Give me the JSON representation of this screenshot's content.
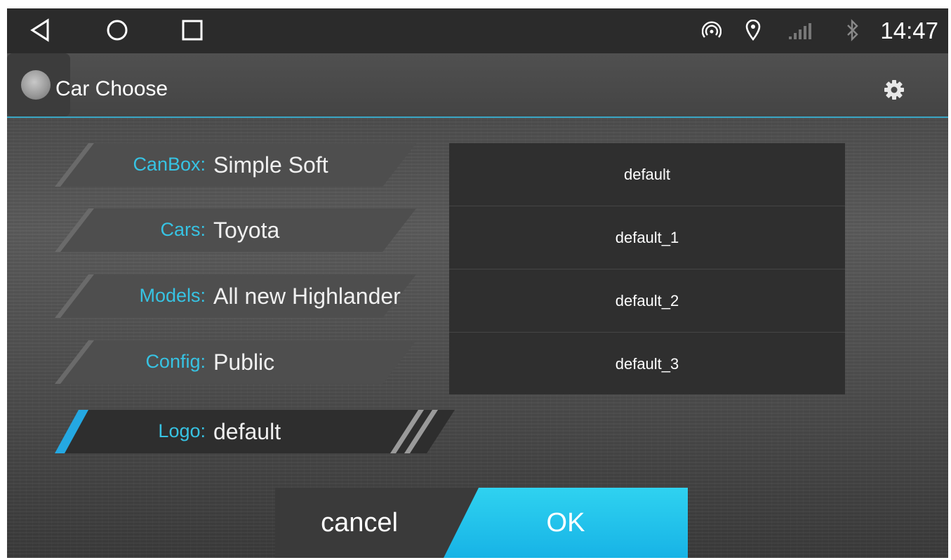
{
  "status_bar": {
    "nav_icons": [
      "back-icon",
      "home-icon",
      "recents-icon"
    ],
    "status_icons": [
      "hotspot-icon",
      "location-icon",
      "signal-icon",
      "bluetooth-icon"
    ],
    "time": "14:47"
  },
  "title_bar": {
    "title": "Car Choose",
    "settings_icon": "gear-icon"
  },
  "settings_rows": [
    {
      "label": "CanBox:",
      "value": "Simple Soft"
    },
    {
      "label": "Cars:",
      "value": "Toyota"
    },
    {
      "label": "Models:",
      "value": "All new Highlander"
    },
    {
      "label": "Config:",
      "value": "Public"
    },
    {
      "label": "Logo:",
      "value": "default"
    }
  ],
  "logo_list": [
    "default",
    "default_1",
    "default_2",
    "default_3"
  ],
  "buttons": {
    "cancel": "cancel",
    "ok": "OK"
  },
  "colors": {
    "accent": "#37c3e3",
    "ok_button": "#1fc3ec",
    "active_stripe": "#24a8e2"
  }
}
